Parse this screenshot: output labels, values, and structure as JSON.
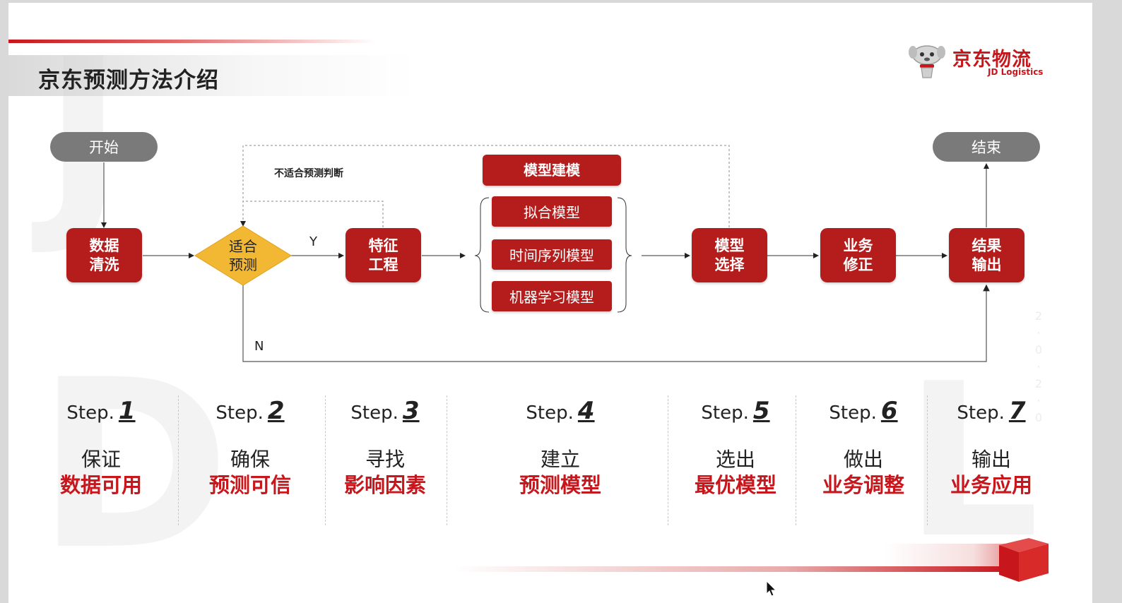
{
  "slide": {
    "title": "京东预测方法介绍",
    "logo_cn": "京东物流",
    "logo_en": "JD Logistics",
    "watermark_letters": [
      "J",
      "D",
      "L"
    ],
    "vertical_deco": "2\n·\n0\n·\n2\n·\n0"
  },
  "flow": {
    "start": "开始",
    "end": "结束",
    "data_clean": "数据\n清洗",
    "decision": "适合\n预测",
    "decision_yes": "Y",
    "decision_no": "N",
    "unsuitable_note": "不适合预测判断",
    "feature": "特征\n工程",
    "modeling_header": "模型建模",
    "models": [
      "拟合模型",
      "时间序列模型",
      "机器学习模型"
    ],
    "model_select": "模型\n选择",
    "biz_adjust": "业务\n修正",
    "output": "结果\n输出"
  },
  "steps": [
    {
      "label": "Step.",
      "num": "1",
      "verb": "保证",
      "goal": "数据可用"
    },
    {
      "label": "Step.",
      "num": "2",
      "verb": "确保",
      "goal": "预测可信"
    },
    {
      "label": "Step.",
      "num": "3",
      "verb": "寻找",
      "goal": "影响因素"
    },
    {
      "label": "Step.",
      "num": "4",
      "verb": "建立",
      "goal": "预测模型"
    },
    {
      "label": "Step.",
      "num": "5",
      "verb": "选出",
      "goal": "最优模型"
    },
    {
      "label": "Step.",
      "num": "6",
      "verb": "做出",
      "goal": "业务调整"
    },
    {
      "label": "Step.",
      "num": "7",
      "verb": "输出",
      "goal": "业务应用"
    }
  ],
  "colors": {
    "brand_red": "#c7161c",
    "box_red": "#b51d1d",
    "decision_yellow": "#f2b733",
    "pill_gray": "#7a7a7a"
  }
}
